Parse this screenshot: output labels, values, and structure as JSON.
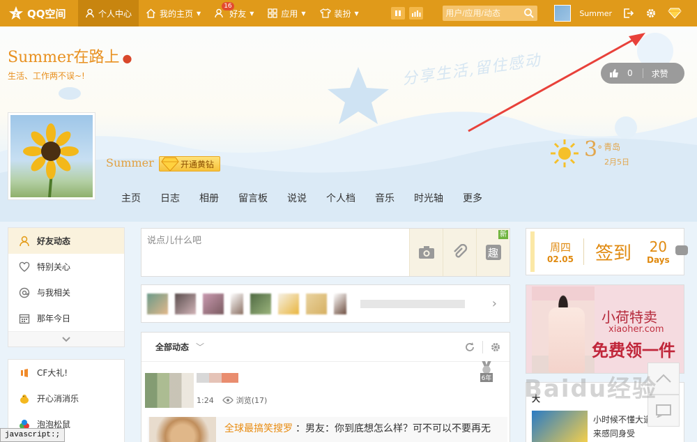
{
  "topbar": {
    "logo_text": "QQ空间",
    "nav": [
      {
        "label": "个人中心",
        "icon": "person-icon",
        "active": true
      },
      {
        "label": "我的主页",
        "icon": "home-icon"
      },
      {
        "label": "好友",
        "icon": "friends-icon",
        "badge": "16"
      },
      {
        "label": "应用",
        "icon": "apps-grid-icon"
      },
      {
        "label": "装扮",
        "icon": "shirt-icon"
      }
    ],
    "search_placeholder": "用户/应用/动态",
    "user_name": "Summer"
  },
  "banner": {
    "title": "Summer在路上",
    "subtitle": "生活、工作两不误~!",
    "slogan": "分享生活,留住感动",
    "like_count": "0",
    "like_request": "求赞",
    "profile_name": "Summer",
    "vip_button": "开通黄钻",
    "weather": {
      "temperature": "3",
      "unit": "°",
      "city": "青岛",
      "date": "2月5日"
    },
    "subnav": [
      "主页",
      "日志",
      "相册",
      "留言板",
      "说说",
      "个人档",
      "音乐",
      "时光轴",
      "更多"
    ]
  },
  "left_menu": {
    "items": [
      {
        "label": "好友动态",
        "icon": "person-icon",
        "active": true
      },
      {
        "label": "特别关心",
        "icon": "heart-icon"
      },
      {
        "label": "与我相关",
        "icon": "at-icon"
      },
      {
        "label": "那年今日",
        "icon": "calendar-icon"
      }
    ],
    "apps": [
      {
        "label": "CF大礼!",
        "icon": "cf-icon"
      },
      {
        "label": "开心消消乐",
        "icon": "chick-icon"
      },
      {
        "label": "泡泡松鼠",
        "icon": "bubble-icon"
      }
    ]
  },
  "composer": {
    "placeholder": "说点儿什么吧",
    "new_tag": "新",
    "fun_label": "趣"
  },
  "feed": {
    "filter_label": "全部动态",
    "post": {
      "time": "1:24",
      "views": "浏览(17)",
      "medal": "6年",
      "share_title": "全球最搞笑搜罗",
      "share_text": "：男友：你到底想怎么样？可不可以不要再无"
    }
  },
  "checkin": {
    "weekday": "周四",
    "date": "02.05",
    "sign": "签到",
    "days_number": "20",
    "days_unit": "Days"
  },
  "ad": {
    "brand": "小荷特卖",
    "url": "xiaoher.com",
    "cta": "免费领一件"
  },
  "side_card": {
    "title": "大",
    "line1": "小时候不懂大道",
    "line2": "来感同身受"
  },
  "watermark": "Baidu经验",
  "status_bar": "javascript:;",
  "colors": {
    "brand": "#e09a1a",
    "accent": "#e8901f",
    "arrow": "#e8413a"
  }
}
